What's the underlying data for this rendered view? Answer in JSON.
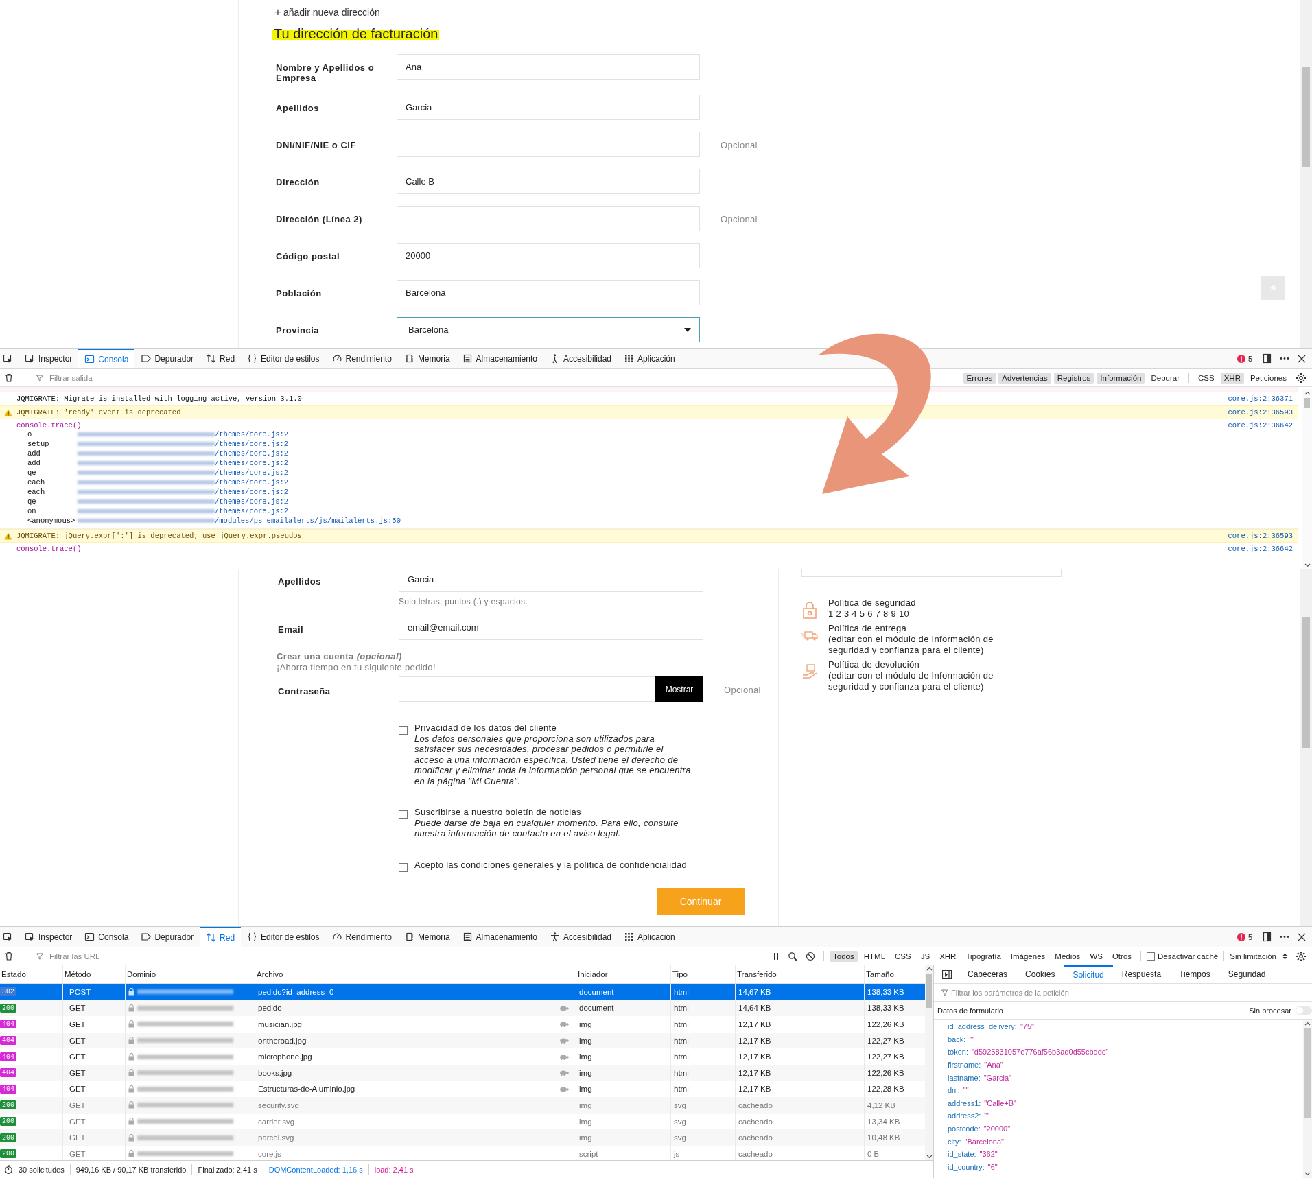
{
  "page_top": {
    "add_address": {
      "icon": "+",
      "label": "añadir nueva dirección"
    },
    "heading": "Tu dirección de facturación",
    "fields": [
      {
        "kind": "text",
        "label": "Nombre y Apellidos o Empresa",
        "value": "Ana"
      },
      {
        "kind": "text",
        "label": "Apellidos",
        "value": "Garcia"
      },
      {
        "kind": "text",
        "label": "DNI/NIF/NIE o CIF",
        "note": "Opcional"
      },
      {
        "kind": "text",
        "label": "Dirección",
        "value": "Calle B"
      },
      {
        "kind": "text",
        "label": "Dirección (Línea 2)",
        "note": "Opcional"
      },
      {
        "kind": "text",
        "label": "Código postal",
        "value": "20000"
      },
      {
        "kind": "text",
        "label": "Población",
        "value": "Barcelona"
      },
      {
        "kind": "select",
        "label": "Provincia",
        "value": "Barcelona"
      }
    ]
  },
  "console": {
    "tabs": [
      {
        "label": "Inspector",
        "selected": false
      },
      {
        "label": "Consola",
        "selected": true
      },
      {
        "label": "Depurador",
        "selected": false
      },
      {
        "label": "Red",
        "selected": false
      },
      {
        "label": "Editor de estilos",
        "selected": false
      },
      {
        "label": "Rendimiento",
        "selected": false
      },
      {
        "label": "Memoria",
        "selected": false
      },
      {
        "label": "Almacenamiento",
        "selected": false
      },
      {
        "label": "Accesibilidad",
        "selected": false
      },
      {
        "label": "Aplicación",
        "selected": false
      }
    ],
    "error_count": "5",
    "filter_placeholder": "Filtrar salida",
    "filters": [
      {
        "label": "Errores",
        "on": true
      },
      {
        "label": "Advertencias",
        "on": true
      },
      {
        "label": "Registros",
        "on": true
      },
      {
        "label": "Información",
        "on": true
      },
      {
        "label": "Depurar",
        "on": false
      },
      {
        "label": "CSS",
        "on": false
      },
      {
        "label": "XHR",
        "on": true
      },
      {
        "label": "Peticiones",
        "on": false
      }
    ],
    "messages": [
      {
        "kind": "log",
        "text": "JQMIGRATE: Migrate is installed with logging active, version 3.1.0",
        "source": "core.js:2:36371"
      },
      {
        "kind": "warning",
        "text": "JQMIGRATE: 'ready' event is deprecated",
        "source": "core.js:2:36593"
      },
      {
        "kind": "trace",
        "text": "console.trace()",
        "source": "core.js:2:36642",
        "frames": [
          {
            "fn": "o",
            "path": "/themes/core.js:2"
          },
          {
            "fn": "setup",
            "path": "/themes/core.js:2"
          },
          {
            "fn": "add",
            "path": "/themes/core.js:2"
          },
          {
            "fn": "add",
            "path": "/themes/core.js:2"
          },
          {
            "fn": "qe",
            "path": "/themes/core.js:2"
          },
          {
            "fn": "each",
            "path": "/themes/core.js:2"
          },
          {
            "fn": "each",
            "path": "/themes/core.js:2"
          },
          {
            "fn": "qe",
            "path": "/themes/core.js:2"
          },
          {
            "fn": "on",
            "path": "/themes/core.js:2"
          },
          {
            "fn": "<anonymous>",
            "path": "/modules/ps_emailalerts/js/mailalerts.js:50"
          }
        ]
      },
      {
        "kind": "warning",
        "text": "JQMIGRATE: jQuery.expr[':'] is deprecated; use jQuery.expr.pseudos",
        "source": "core.js:2:36593"
      },
      {
        "kind": "trace",
        "text": "console.trace()",
        "source": "core.js:2:36642"
      }
    ]
  },
  "page_bottom": {
    "fields": [
      {
        "kind": "text",
        "label": "Apellidos",
        "value": "Garcia",
        "hint": "Solo letras, puntos (.) y espacios."
      },
      {
        "kind": "text",
        "label": "Email",
        "value": "email@email.com"
      }
    ],
    "account": {
      "title": "Crear una cuenta *(opcional)*",
      "subtitle": "¡Ahorra tiempo en tu siguiente pedido!"
    },
    "password": {
      "label": "Contraseña",
      "button": "Mostrar",
      "note": "Opcional"
    },
    "checkboxes": [
      {
        "label": "Privacidad de los datos del cliente",
        "description": "Los datos personales que proporciona son utilizados para satisfacer sus necesidades, procesar pedidos o permitirle el acceso a una información específica. Usted tiene el derecho de modificar y eliminar toda la información personal que se encuentra en la página \"Mi Cuenta\".",
        "checked": false
      },
      {
        "label": "Suscribirse a nuestro boletín de noticias",
        "description": "Puede darse de baja en cualquier momento. Para ello, consulte nuestra información de contacto en el aviso legal.",
        "checked": false
      },
      {
        "label": "Acepto las condiciones generales y la política de confidencialidad",
        "checked": false
      }
    ],
    "submit": "Continuar",
    "policies": [
      {
        "kind": "security",
        "title": "Política de seguridad",
        "text": "1 2 3 4 5 6 7 8 9 10"
      },
      {
        "kind": "delivery",
        "title": "Política de entrega",
        "text": "(editar con el módulo de Información de seguridad y confianza para el cliente)"
      },
      {
        "kind": "return",
        "title": "Política de devolución",
        "text": "(editar con el módulo de Información de seguridad y confianza para el cliente)"
      }
    ]
  },
  "network": {
    "tabs": [
      {
        "label": "Inspector",
        "selected": false
      },
      {
        "label": "Consola",
        "selected": false
      },
      {
        "label": "Depurador",
        "selected": false
      },
      {
        "label": "Red",
        "selected": true
      },
      {
        "label": "Editor de estilos",
        "selected": false
      },
      {
        "label": "Rendimiento",
        "selected": false
      },
      {
        "label": "Memoria",
        "selected": false
      },
      {
        "label": "Almacenamiento",
        "selected": false
      },
      {
        "label": "Accesibilidad",
        "selected": false
      },
      {
        "label": "Aplicación",
        "selected": false
      }
    ],
    "error_count": "5",
    "filter_placeholder": "Filtrar las URL",
    "types": [
      {
        "label": "Todos",
        "selected": true
      },
      {
        "label": "HTML",
        "selected": false
      },
      {
        "label": "CSS",
        "selected": false
      },
      {
        "label": "JS",
        "selected": false
      },
      {
        "label": "XHR",
        "selected": false
      },
      {
        "label": "Tipografía",
        "selected": false
      },
      {
        "label": "Imágenes",
        "selected": false
      },
      {
        "label": "Medios",
        "selected": false
      },
      {
        "label": "WS",
        "selected": false
      },
      {
        "label": "Otros",
        "selected": false
      }
    ],
    "disable_cache": {
      "label": "Desactivar caché",
      "checked": false
    },
    "throttling": "Sin limitación",
    "columns": [
      "Estado",
      "Método",
      "Dominio",
      "Archivo",
      "Iniciador",
      "Tipo",
      "Transferido",
      "Tamaño"
    ],
    "rows": [
      {
        "status": "302",
        "color": "#3a7bd5",
        "method": "POST",
        "file": "pedido?id_address=0",
        "initiator": "document",
        "type": "html",
        "transferred": "14,67 KB",
        "size": "138,33 KB",
        "selected": true,
        "throttled": false,
        "cached": false
      },
      {
        "status": "200",
        "color": "#1e8f3a",
        "method": "GET",
        "file": "pedido",
        "initiator": "document",
        "type": "html",
        "transferred": "14,64 KB",
        "size": "138,33 KB",
        "selected": false,
        "throttled": true,
        "cached": false
      },
      {
        "status": "404",
        "color": "#d62ad6",
        "method": "GET",
        "file": "musician.jpg",
        "initiator": "img",
        "type": "html",
        "transferred": "12,17 KB",
        "size": "122,26 KB",
        "selected": false,
        "throttled": true,
        "cached": false
      },
      {
        "status": "404",
        "color": "#d62ad6",
        "method": "GET",
        "file": "ontheroad.jpg",
        "initiator": "img",
        "type": "html",
        "transferred": "12,17 KB",
        "size": "122,27 KB",
        "selected": false,
        "throttled": true,
        "cached": false
      },
      {
        "status": "404",
        "color": "#d62ad6",
        "method": "GET",
        "file": "microphone.jpg",
        "initiator": "img",
        "type": "html",
        "transferred": "12,17 KB",
        "size": "122,27 KB",
        "selected": false,
        "throttled": true,
        "cached": false
      },
      {
        "status": "404",
        "color": "#d62ad6",
        "method": "GET",
        "file": "books.jpg",
        "initiator": "img",
        "type": "html",
        "transferred": "12,17 KB",
        "size": "122,26 KB",
        "selected": false,
        "throttled": true,
        "cached": false
      },
      {
        "status": "404",
        "color": "#d62ad6",
        "method": "GET",
        "file": "Estructuras-de-Aluminio.jpg",
        "initiator": "img",
        "type": "html",
        "transferred": "12,17 KB",
        "size": "122,28 KB",
        "selected": false,
        "throttled": true,
        "cached": false
      },
      {
        "status": "200",
        "color": "#1e8f3a",
        "method": "GET",
        "file": "security.svg",
        "initiator": "img",
        "type": "svg",
        "transferred": "cacheado",
        "size": "4,12 KB",
        "selected": false,
        "throttled": false,
        "cached": true
      },
      {
        "status": "200",
        "color": "#1e8f3a",
        "method": "GET",
        "file": "carrier.svg",
        "initiator": "img",
        "type": "svg",
        "transferred": "cacheado",
        "size": "13,34 KB",
        "selected": false,
        "throttled": false,
        "cached": true
      },
      {
        "status": "200",
        "color": "#1e8f3a",
        "method": "GET",
        "file": "parcel.svg",
        "initiator": "img",
        "type": "svg",
        "transferred": "cacheado",
        "size": "10,48 KB",
        "selected": false,
        "throttled": false,
        "cached": true
      },
      {
        "status": "200",
        "color": "#1e8f3a",
        "method": "GET",
        "file": "core.js",
        "initiator": "script",
        "type": "js",
        "transferred": "cacheado",
        "size": "0 B",
        "selected": false,
        "throttled": false,
        "cached": true
      }
    ],
    "summary": [
      {
        "kind": "plain",
        "text": "30 solicitudes"
      },
      {
        "kind": "plain",
        "text": "949,16 KB / 90,17 KB transferido"
      },
      {
        "kind": "plain",
        "text": "Finalizado: 2,41 s"
      },
      {
        "kind": "dom",
        "text": "DOMContentLoaded: 1,16 s"
      },
      {
        "kind": "load",
        "text": "load: 2,41 s"
      }
    ],
    "detail": {
      "tabs": [
        {
          "label": "Cabeceras",
          "selected": false
        },
        {
          "label": "Cookies",
          "selected": false
        },
        {
          "label": "Solicitud",
          "selected": true
        },
        {
          "label": "Respuesta",
          "selected": false
        },
        {
          "label": "Tiempos",
          "selected": false
        },
        {
          "label": "Seguridad",
          "selected": false
        }
      ],
      "filter_placeholder": "Filtrar los parámetros de la petición",
      "section": "Datos de formulario",
      "raw": {
        "label": "Sin procesar",
        "on": false
      },
      "params": [
        {
          "key": "id_address_delivery:",
          "value": "\"75\""
        },
        {
          "key": "back:",
          "value": "\"\""
        },
        {
          "key": "token:",
          "value": "\"d5925831057e776af56b3ad0d55cbddc\""
        },
        {
          "key": "firstname:",
          "value": "\"Ana\""
        },
        {
          "key": "lastname:",
          "value": "\"Garcia\""
        },
        {
          "key": "dni:",
          "value": "\"\""
        },
        {
          "key": "address1:",
          "value": "\"Calle+B\""
        },
        {
          "key": "address2:",
          "value": "\"\""
        },
        {
          "key": "postcode:",
          "value": "\"20000\""
        },
        {
          "key": "city:",
          "value": "\"Barcelona\""
        },
        {
          "key": "id_state:",
          "value": "\"362\""
        },
        {
          "key": "id_country:",
          "value": "\"6\""
        }
      ]
    }
  }
}
